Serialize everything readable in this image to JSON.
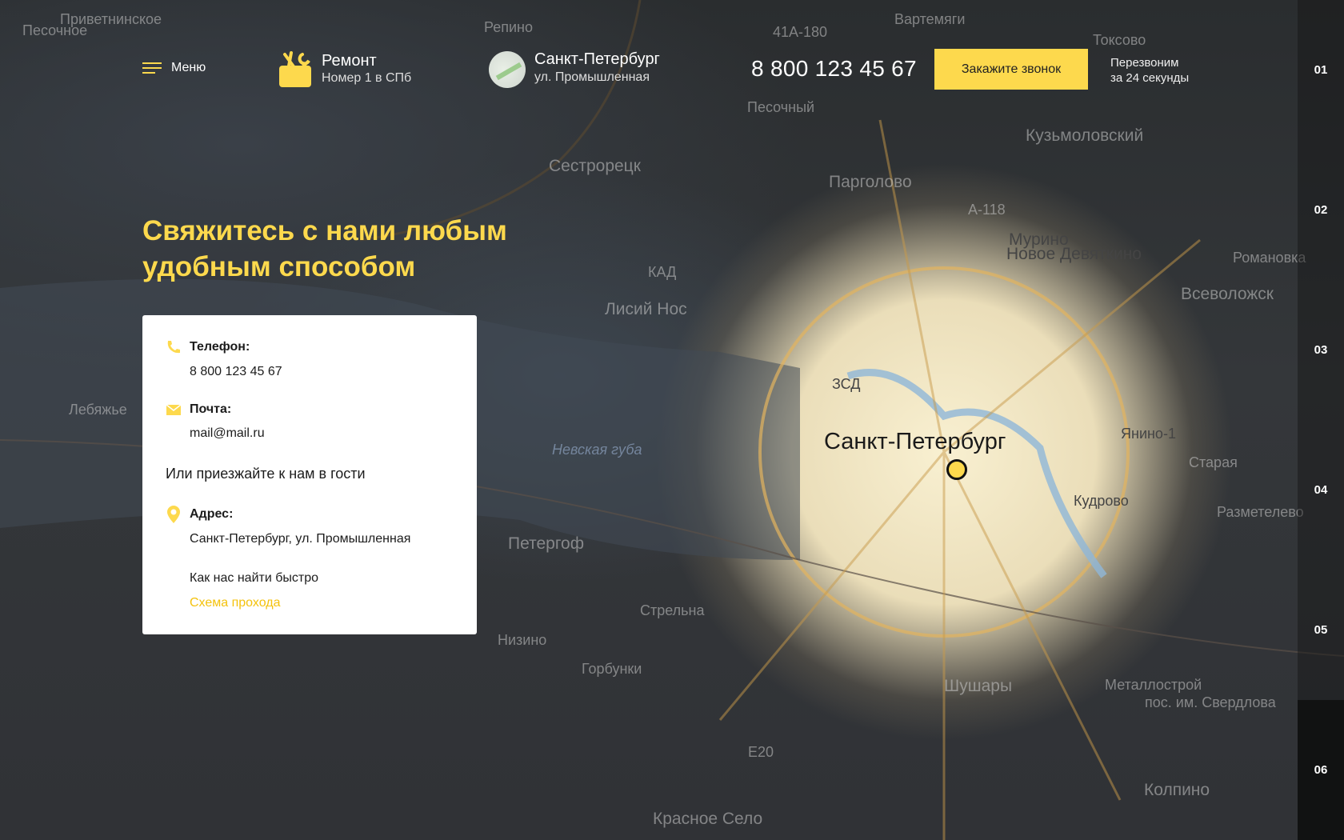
{
  "header": {
    "menu_label": "Меню",
    "logo": {
      "title": "Ремонт",
      "subtitle": "Номер 1 в СПб"
    },
    "city": {
      "name": "Санкт-Петербург",
      "street": "ул. Промышленная"
    },
    "phone": "8 800 123 45 67",
    "cta_label": "Закажите звонок",
    "callback": {
      "line1": "Перезвоним",
      "line2": "за 24 секунды"
    }
  },
  "main": {
    "heading_line1": "Свяжитесь с нами любым",
    "heading_line2": "удобным способом",
    "card": {
      "phone_label": "Телефон:",
      "phone_value": "8 800 123 45 67",
      "mail_label": "Почта:",
      "mail_value": "mail@mail.ru",
      "visit_text": "Или приезжайте к нам в гости",
      "address_label": "Адрес:",
      "address_value": "Санкт-Петербург, ул. Промышленная",
      "find_text": "Как нас найти быстро",
      "route_link": "Схема прохода"
    }
  },
  "rail": {
    "items": [
      "01",
      "02",
      "03",
      "04",
      "05",
      "06"
    ],
    "active": "06"
  },
  "map": {
    "labels": [
      "Приветнинское",
      "Песочное",
      "Репино",
      "Вартемяги",
      "Токсово",
      "Песочный",
      "Кузьмоловский",
      "Сестрорецк",
      "Парголово",
      "Мурино",
      "Новое Девяткино",
      "Романовка",
      "Всеволожск",
      "Лисий Нос",
      "Лебяжье",
      "Невская губа",
      "Санкт-Петербург",
      "Янино-1",
      "Старая",
      "Кудрово",
      "Разметелево",
      "Петергоф",
      "Стрельна",
      "Низино",
      "Горбунки",
      "Шушары",
      "Металлострой",
      "пос. им. Свердлова",
      "Колпино",
      "Красное Село",
      "КАД",
      "ЗСД",
      "А-118",
      "41А-180",
      "E20"
    ]
  },
  "colors": {
    "accent": "#fdd94d",
    "link": "#f4c20d",
    "card": "#ffffff"
  }
}
